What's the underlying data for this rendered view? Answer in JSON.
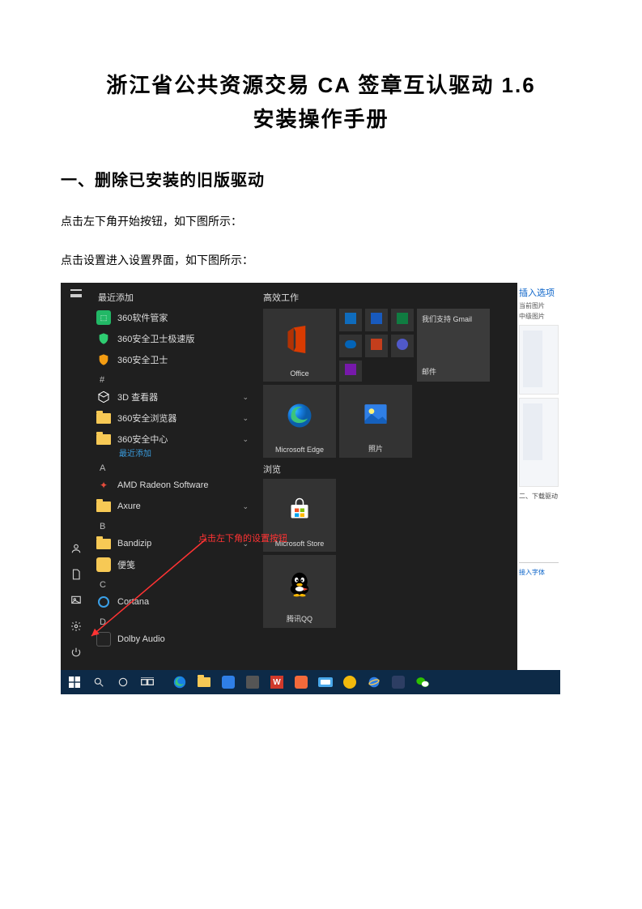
{
  "doc": {
    "title_l1": "浙江省公共资源交易 CA 签章互认驱动 1.6",
    "title_l2": "安装操作手册",
    "h2": "一、删除已安装的旧版驱动",
    "p1": "点击左下角开始按钮，如下图所示：",
    "p2": "点击设置进入设置界面，如下图所示："
  },
  "start": {
    "recent": "最近添加",
    "apps": [
      {
        "name": "360软件管家",
        "color": "#2cc36b"
      },
      {
        "name": "360安全卫士极速版",
        "shield": "green"
      },
      {
        "name": "360安全卫士",
        "shield": "orange"
      }
    ],
    "letter_hash": "#",
    "a3d": "3D 查看器",
    "a360b": "360安全浏览器",
    "a360c": "360安全中心",
    "a360c_sub": "最近添加",
    "letter_a": "A",
    "amd": "AMD Radeon Software",
    "axure": "Axure",
    "letter_b": "B",
    "bandi": "Bandizip",
    "note": "便笺",
    "letter_c": "C",
    "cortana": "Cortana",
    "letter_d": "D",
    "dolby": "Dolby Audio"
  },
  "tiles": {
    "group": "高效工作",
    "office": "Office",
    "gmail": "我们支持 Gmail",
    "mail": "邮件",
    "edge": "Microsoft Edge",
    "photos": "照片",
    "browse": "浏览",
    "store": "Microsoft Store",
    "qq": "腾讯QQ"
  },
  "anno": "点击左下角的设置按钮",
  "right": {
    "t1": "插入选项",
    "t2": "当前图片",
    "t3": "中级图片",
    "t4": "二、下载驱动",
    "t5": "接入字体"
  }
}
